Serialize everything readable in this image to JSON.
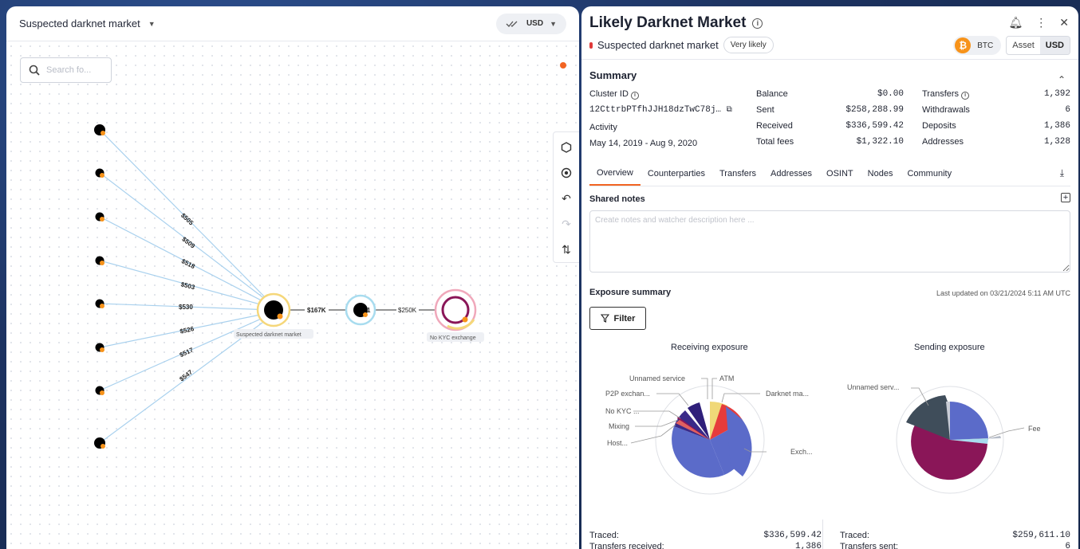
{
  "left": {
    "title": "Suspected darknet market",
    "currency": "USD",
    "search_placeholder": "Search fo...",
    "graph": {
      "edge_labels": [
        "$505",
        "$509",
        "$518",
        "$503",
        "$530",
        "$526",
        "$517",
        "$547"
      ],
      "mid_edge_label": "$167K",
      "mid_node_count": "1",
      "right_edge_label": "$250K",
      "hub_caption": "Suspected darknet market",
      "exchange_caption": "No KYC exchange"
    },
    "toolbar_icons": [
      "hexagon-icon",
      "target-icon",
      "undo-icon",
      "redo-icon",
      "sort-icon"
    ]
  },
  "right": {
    "title": "Likely Darknet Market",
    "category": "Suspected darknet market",
    "likelihood": "Very likely",
    "asset": "BTC",
    "toggle": [
      "Asset",
      "USD"
    ],
    "summary": {
      "title": "Summary",
      "cluster_id_label": "Cluster ID",
      "cluster_id": "12CttrbPTfhJJH18dzTwC78j…",
      "activity_label": "Activity",
      "activity": "May 14, 2019 - Aug 9, 2020",
      "balance_label": "Balance",
      "balance": "$0.00",
      "sent_label": "Sent",
      "sent": "$258,288.99",
      "received_label": "Received",
      "received": "$336,599.42",
      "fees_label": "Total fees",
      "fees": "$1,322.10",
      "transfers_label": "Transfers",
      "transfers": "1,392",
      "withdrawals_label": "Withdrawals",
      "withdrawals": "6",
      "deposits_label": "Deposits",
      "deposits": "1,386",
      "addresses_label": "Addresses",
      "addresses": "1,328"
    },
    "tabs": [
      "Overview",
      "Counterparties",
      "Transfers",
      "Addresses",
      "OSINT",
      "Nodes",
      "Community"
    ],
    "notes": {
      "title": "Shared notes",
      "placeholder": "Create notes and watcher description here ..."
    },
    "exposure": {
      "title": "Exposure summary",
      "updated": "Last updated on 03/21/2024 5:11 AM UTC",
      "filter_label": "Filter",
      "receiving_title": "Receiving exposure",
      "sending_title": "Sending exposure",
      "receiving_labels": [
        "Unnamed service",
        "ATM",
        "P2P exchan...",
        "Darknet ma...",
        "No KYC ...",
        "Mixing",
        "Host...",
        "Exch..."
      ],
      "sending_labels": [
        "Unnamed serv...",
        "Fee"
      ]
    },
    "totals": {
      "traced_label": "Traced:",
      "traced_received": "$336,599.42",
      "transfers_received_label": "Transfers received:",
      "transfers_received": "1,386",
      "traced_sent": "$259,611.10",
      "transfers_sent_label": "Transfers sent:",
      "transfers_sent": "6"
    }
  }
}
